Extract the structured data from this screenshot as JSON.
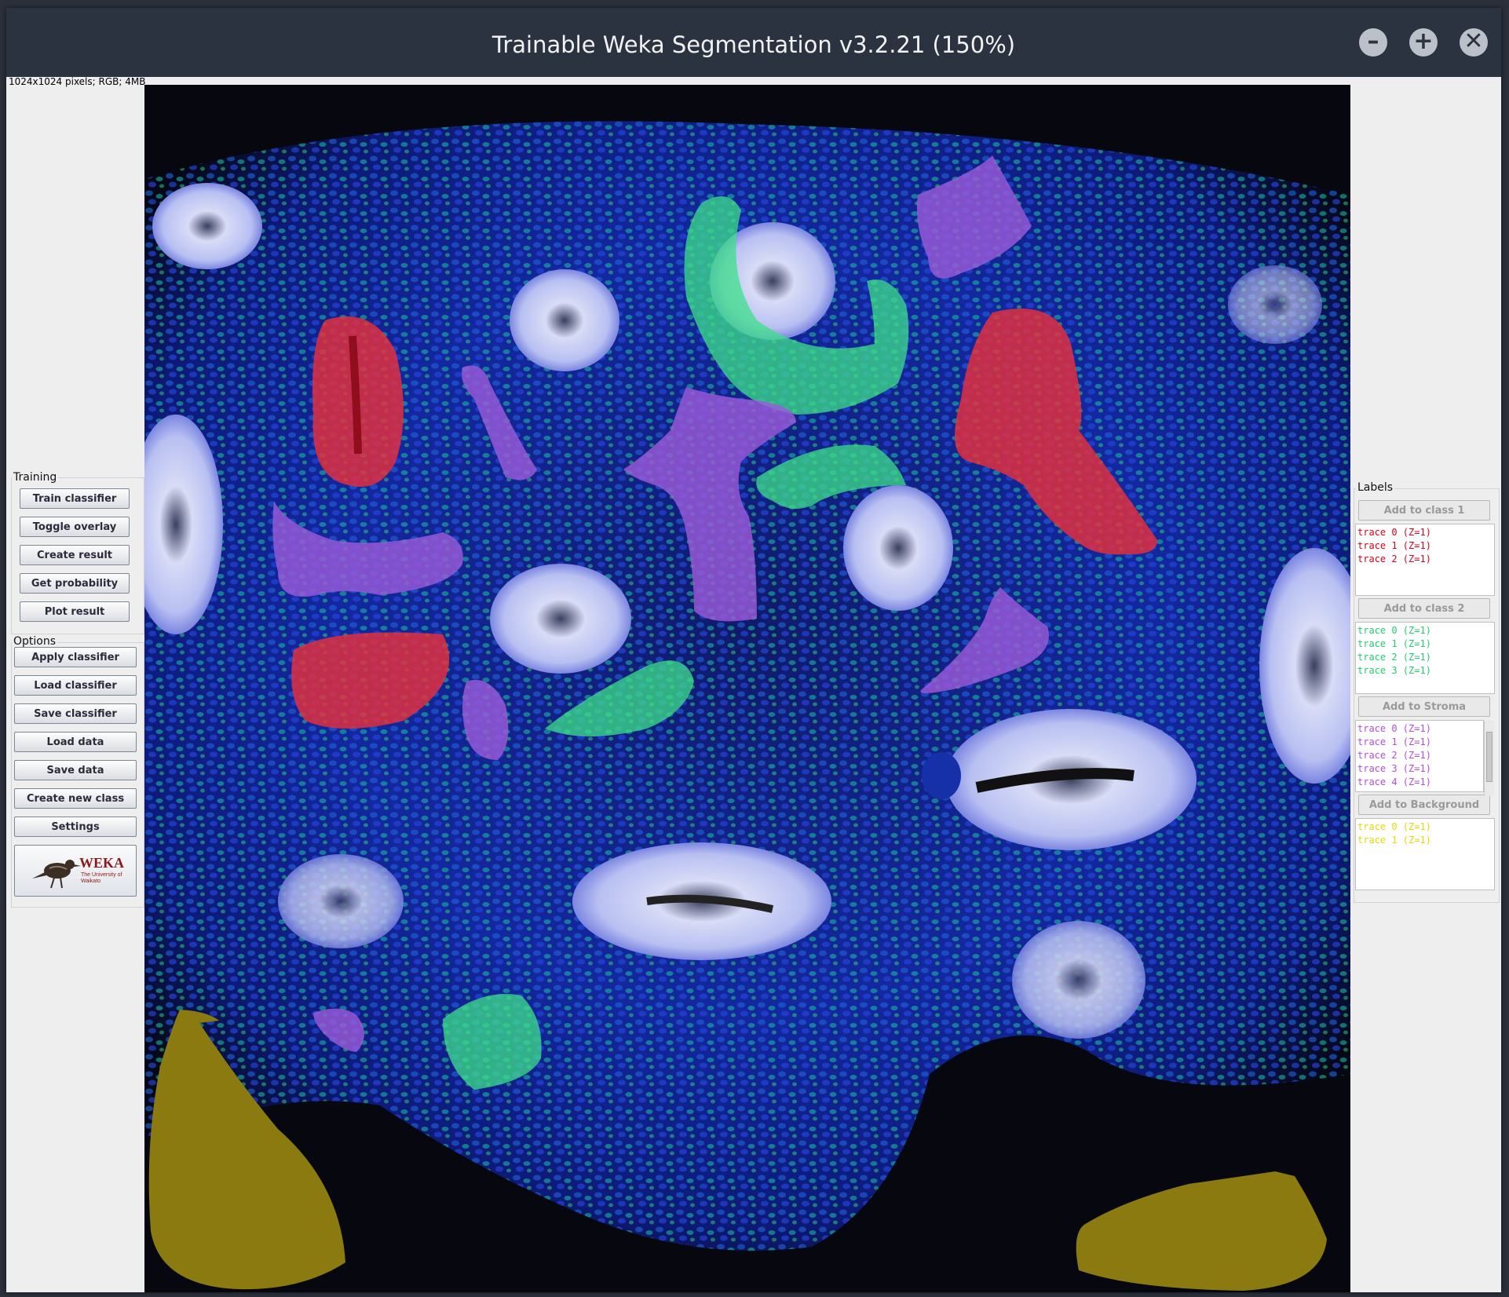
{
  "window": {
    "title": "Trainable Weka Segmentation v3.2.21 (150%)",
    "controls": {
      "minimize": "–",
      "maximize": "+",
      "close": "✕"
    }
  },
  "image_info": "1024x1024 pixels; RGB; 4MB",
  "training": {
    "title": "Training",
    "buttons": [
      "Train classifier",
      "Toggle overlay",
      "Create result",
      "Get probability",
      "Plot result"
    ]
  },
  "options": {
    "title": "Options",
    "buttons": [
      "Apply classifier",
      "Load classifier",
      "Save classifier",
      "Load data",
      "Save data",
      "Create new class",
      "Settings"
    ]
  },
  "logo": {
    "text": "WEKA",
    "subtitle": "The University of Waikato"
  },
  "labels": {
    "title": "Labels",
    "classes": [
      {
        "button": "Add to class 1",
        "color": "#e0001a",
        "traces": [
          "trace 0 (Z=1)",
          "trace 1 (Z=1)",
          "trace 2 (Z=1)"
        ]
      },
      {
        "button": "Add to class 2",
        "color": "#20d070",
        "traces": [
          "trace 0 (Z=1)",
          "trace 1 (Z=1)",
          "trace 2 (Z=1)",
          "trace 3 (Z=1)"
        ]
      },
      {
        "button": "Add to Stroma",
        "color": "#b44dde",
        "traces": [
          "trace 0 (Z=1)",
          "trace 1 (Z=1)",
          "trace 2 (Z=1)",
          "trace 3 (Z=1)",
          "trace 4 (Z=1)"
        ]
      },
      {
        "button": "Add to Background",
        "color": "#e6d800",
        "traces": [
          "trace 0 (Z=1)",
          "trace 1 (Z=1)"
        ]
      }
    ]
  },
  "overlay_colors": {
    "class1": "#e8303a",
    "class2": "#3ee08a",
    "stroma": "#9a5ad8",
    "background": "#8a7a10"
  }
}
